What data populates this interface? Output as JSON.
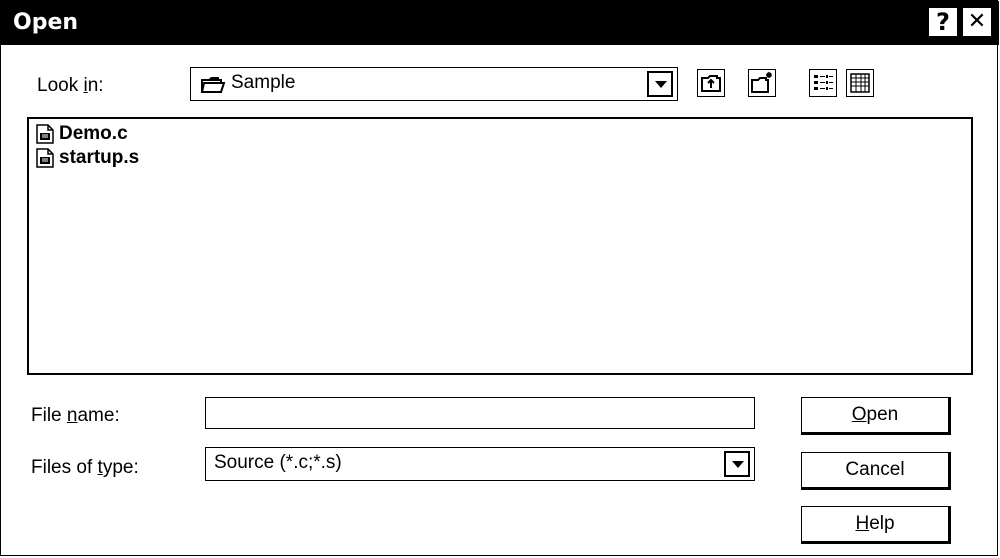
{
  "window": {
    "title": "Open",
    "help_glyph": "?",
    "close_glyph": "✕"
  },
  "look_in": {
    "label_pre": "Look ",
    "label_accel": "i",
    "label_post": "n:",
    "value": "Sample"
  },
  "files": [
    {
      "name": "Demo.c",
      "icon": "source-file-icon"
    },
    {
      "name": "startup.s",
      "icon": "source-file-icon"
    }
  ],
  "file_name": {
    "label_pre": "File ",
    "label_accel": "n",
    "label_post": "ame:",
    "value": ""
  },
  "file_type": {
    "label_pre": "Files of ",
    "label_accel": "t",
    "label_post": "ype:",
    "value": "Source (*.c;*.s)"
  },
  "buttons": {
    "open_accel": "O",
    "open_rest": "pen",
    "cancel": "Cancel",
    "help_accel": "H",
    "help_rest": "elp"
  },
  "toolbar_icons": [
    "up-one-level-icon",
    "create-new-folder-icon",
    "list-view-icon",
    "details-view-icon"
  ]
}
